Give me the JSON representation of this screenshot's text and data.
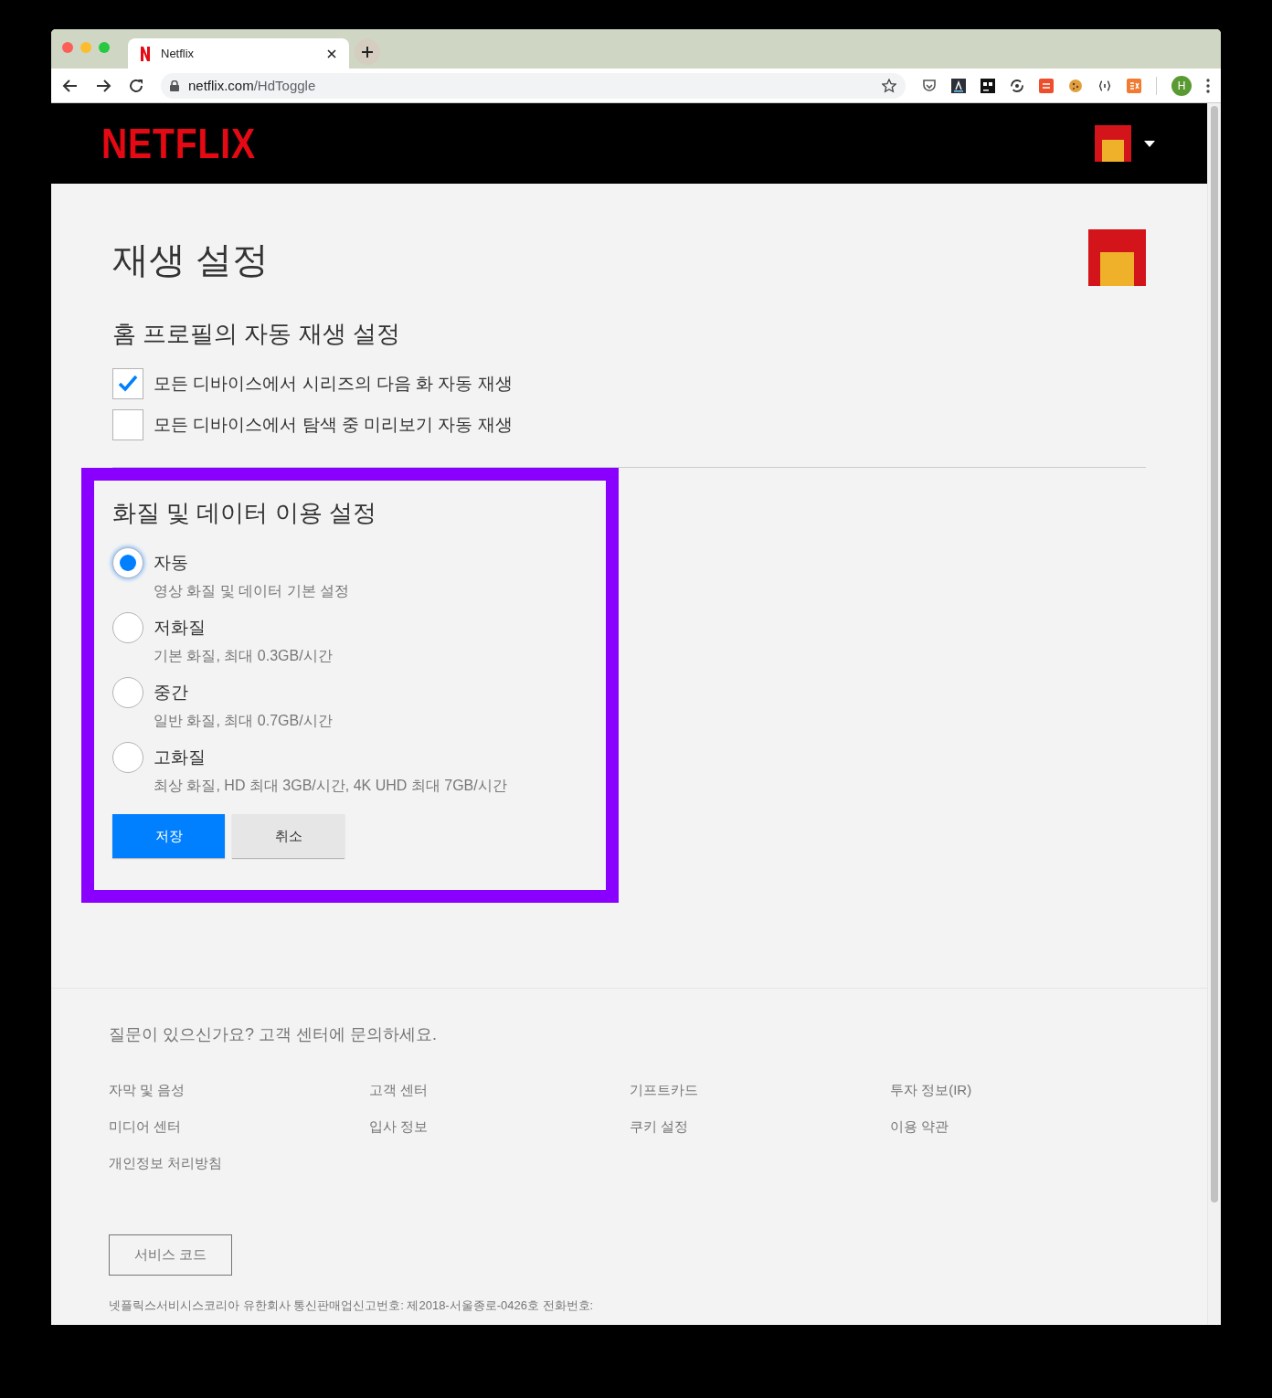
{
  "browser": {
    "tab_title": "Netflix",
    "url_host": "netflix.com",
    "url_path": "/HdToggle",
    "profile_initial": "H"
  },
  "header": {
    "logo": "NETFLIX"
  },
  "page": {
    "title": "재생 설정",
    "autoplay": {
      "title": "홈 프로필의 자동 재생 설정",
      "options": [
        {
          "label": "모든 디바이스에서 시리즈의 다음 화 자동 재생",
          "checked": true
        },
        {
          "label": "모든 디바이스에서 탐색 중 미리보기 자동 재생",
          "checked": false
        }
      ]
    },
    "quality": {
      "title": "화질 및 데이터 이용 설정",
      "highlighted": true,
      "options": [
        {
          "label": "자동",
          "description": "영상 화질 및 데이터 기본 설정",
          "selected": true
        },
        {
          "label": "저화질",
          "description": "기본 화질, 최대 0.3GB/시간",
          "selected": false
        },
        {
          "label": "중간",
          "description": "일반 화질, 최대 0.7GB/시간",
          "selected": false
        },
        {
          "label": "고화질",
          "description": "최상 화질, HD 최대 3GB/시간, 4K UHD 최대 7GB/시간",
          "selected": false
        }
      ],
      "buttons": [
        {
          "label": "저장",
          "kind": "primary"
        },
        {
          "label": "취소",
          "kind": "secondary"
        }
      ]
    }
  },
  "footer": {
    "question": "질문이 있으신가요? 고객 센터에 문의하세요.",
    "links": [
      "자막 및 음성",
      "고객 센터",
      "기프트카드",
      "투자 정보(IR)",
      "미디어 센터",
      "입사 정보",
      "쿠키 설정",
      "이용 약관",
      "개인정보 처리방침"
    ],
    "service_code": "서비스 코드",
    "legal": "넷플릭스서비시스코리아 유한회사 통신판매업신고번호: 제2018-서울종로-0426호 전화번호:"
  }
}
